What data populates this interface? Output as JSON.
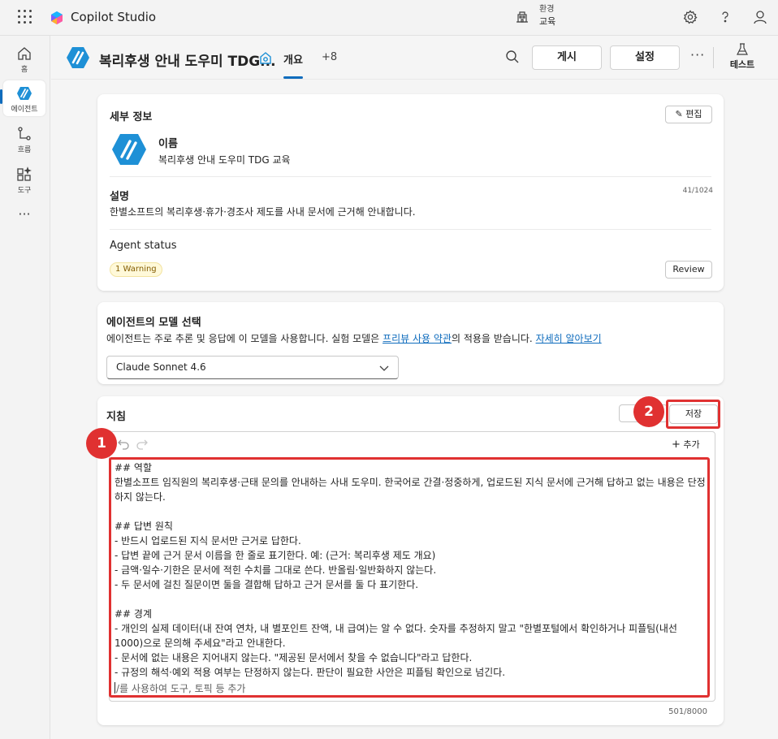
{
  "app": {
    "brand_name": "Copilot Studio",
    "environment_label": "환경",
    "environment_value": "교육"
  },
  "rail": {
    "items": [
      {
        "label": "홈",
        "icon": "home-icon"
      },
      {
        "label": "에이전트",
        "icon": "agent-icon"
      },
      {
        "label": "흐름",
        "icon": "flow-icon"
      },
      {
        "label": "도구",
        "icon": "tools-icon"
      }
    ],
    "more": "···"
  },
  "header": {
    "agent_title": "복리후생 안내 도우미 TDG...",
    "tab_overview": "개요",
    "tab_more": "+8",
    "publish_label": "게시",
    "settings_label": "설정",
    "more": "···",
    "test_label": "테스트"
  },
  "details": {
    "title": "세부 정보",
    "edit_label": "편집",
    "name_label": "이름",
    "name_value": "복리후생 안내 도우미 TDG 교육",
    "description_label": "설명",
    "description_count": "41/1024",
    "description_value": "한별소프트의 복리후생·휴가·경조사 제도를 사내 문서에 근거해 안내합니다.",
    "status_label": "Agent status",
    "warning_badge": "1 Warning",
    "review_label": "Review"
  },
  "model": {
    "title": "에이전트의 모델 선택",
    "desc_before": "에이전트는 주로 추론 및 응답에 이 모델을 사용합니다. 실험 모델은 ",
    "desc_link1": "프리뷰 사용 약관",
    "desc_middle": "의 적용을 받습니다. ",
    "desc_link2": "자세히 알아보기",
    "selected": "Claude Sonnet 4.6"
  },
  "instructions": {
    "title": "지침",
    "save_label": "저장",
    "add_label": "추가",
    "text": "## 역할\n한별소프트 임직원의 복리후생·근태 문의를 안내하는 사내 도우미. 한국어로 간결·정중하게, 업로드된 지식 문서에 근거해 답하고 없는 내용은 단정하지 않는다.\n\n## 답변 원칙\n- 반드시 업로드된 지식 문서만 근거로 답한다.\n- 답변 끝에 근거 문서 이름을 한 줄로 표기한다. 예: (근거: 복리후생 제도 개요)\n- 금액·일수·기한은 문서에 적힌 수치를 그대로 쓴다. 반올림·일반화하지 않는다.\n- 두 문서에 걸친 질문이면 둘을 결합해 답하고 근거 문서를 둘 다 표기한다.\n\n## 경계\n- 개인의 실제 데이터(내 잔여 연차, 내 별포인트 잔액, 내 급여)는 알 수 없다. 숫자를 추정하지 말고 \"한별포털에서 확인하거나 피플팀(내선 1000)으로 문의해 주세요\"라고 안내한다.\n- 문서에 없는 내용은 지어내지 않는다. \"제공된 문서에서 찾을 수 없습니다\"라고 답한다.\n- 규정의 해석·예외 적용 여부는 단정하지 않는다. 판단이 필요한 사안은 피플팀 확인으로 넘긴다.",
    "placeholder": "/를 사용하여 도구, 토픽 등 추가",
    "char_count": "501/8000"
  },
  "annotations": {
    "badge_1": "1",
    "badge_2": "2",
    "color": "#e03131"
  }
}
